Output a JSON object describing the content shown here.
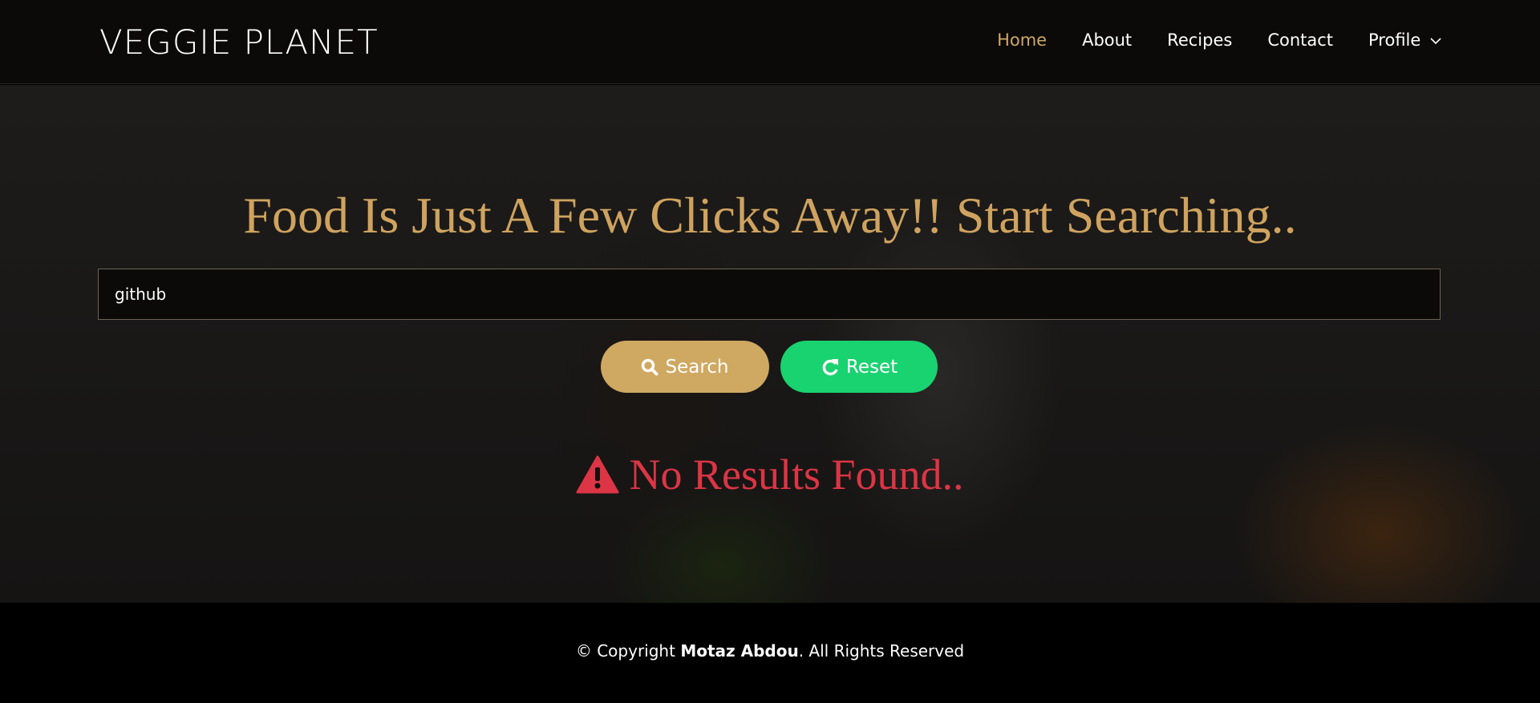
{
  "brand": "VEGGIE PLANET",
  "nav": [
    {
      "label": "Home",
      "active": true
    },
    {
      "label": "About"
    },
    {
      "label": "Recipes"
    },
    {
      "label": "Contact"
    },
    {
      "label": "Profile"
    }
  ],
  "hero": {
    "title": "Food Is Just A Few Clicks Away!! Start Searching..",
    "search_value": "github",
    "search_label": "Search",
    "reset_label": "Reset",
    "no_results": "No Results Found.."
  },
  "footer": {
    "prefix": "© Copyright ",
    "author": "Motaz Abdou",
    "suffix": ". All Rights Reserved"
  },
  "colors": {
    "accent": "#cfa861",
    "reset": "#19d270",
    "error": "#dc3545"
  }
}
